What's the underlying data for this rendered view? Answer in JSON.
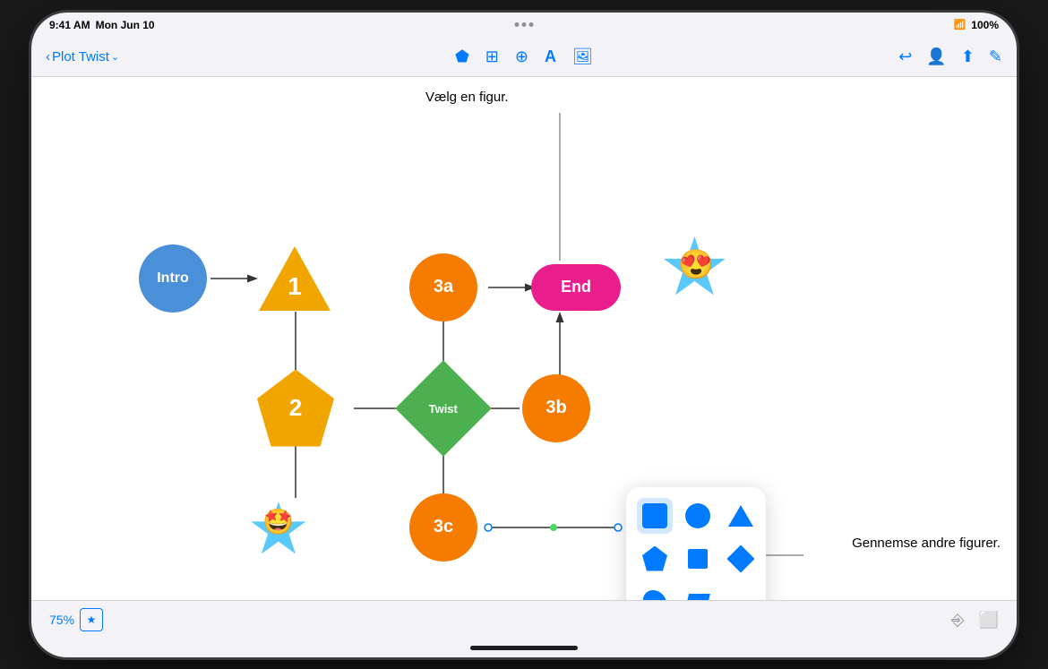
{
  "status": {
    "time": "9:41 AM",
    "day": "Mon Jun 10",
    "wifi": "100%"
  },
  "toolbar": {
    "back_label": "Plot Twist",
    "insert_shapes": "⬟",
    "insert_table": "⊞",
    "insert_chart": "⊕",
    "insert_text": "T",
    "insert_media": "⊡",
    "undo_icon": "↩",
    "collab_icon": "👥",
    "share_icon": "↑",
    "edit_icon": "✎"
  },
  "callouts": {
    "top": "Vælg en figur.",
    "right": "Gennemse andre figurer."
  },
  "shapes": {
    "intro": "Intro",
    "num1": "1",
    "num3a": "3a",
    "end": "End",
    "num2": "2",
    "twist": "Twist",
    "num3b": "3b",
    "num3c": "3c"
  },
  "shape_picker": {
    "items": [
      "square",
      "circle",
      "triangle",
      "pentagon",
      "square-small",
      "diamond",
      "teardrop",
      "parallelogram",
      "more"
    ]
  },
  "bottom": {
    "zoom": "75%",
    "zoom_icon": "★"
  }
}
